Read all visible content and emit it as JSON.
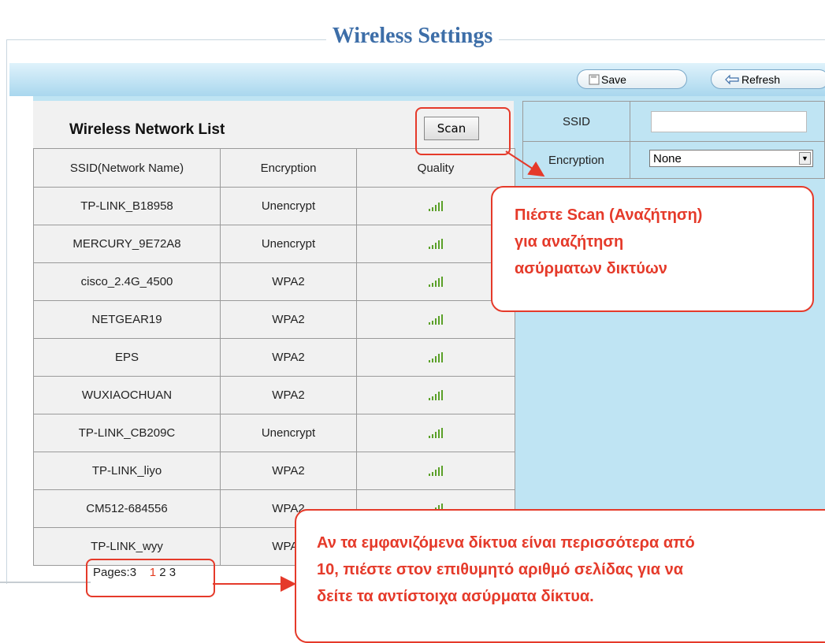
{
  "page": {
    "title": "Wireless Settings"
  },
  "toolbar": {
    "save_label": "Save",
    "refresh_label": "Refresh"
  },
  "network_list": {
    "title": "Wireless Network List",
    "scan_label": "Scan",
    "columns": [
      "SSID(Network Name)",
      "Encryption",
      "Quality"
    ],
    "rows": [
      {
        "ssid": "TP-LINK_B18958",
        "encryption": "Unencrypt"
      },
      {
        "ssid": "MERCURY_9E72A8",
        "encryption": "Unencrypt"
      },
      {
        "ssid": "cisco_2.4G_4500",
        "encryption": "WPA2"
      },
      {
        "ssid": "NETGEAR19",
        "encryption": "WPA2"
      },
      {
        "ssid": "EPS",
        "encryption": "WPA2"
      },
      {
        "ssid": "WUXIAOCHUAN",
        "encryption": "WPA2"
      },
      {
        "ssid": "TP-LINK_CB209C",
        "encryption": "Unencrypt"
      },
      {
        "ssid": "TP-LINK_liyo",
        "encryption": "WPA2"
      },
      {
        "ssid": "CM512-684556",
        "encryption": "WPA2"
      },
      {
        "ssid": "TP-LINK_wyy",
        "encryption": "WPA2"
      }
    ],
    "quality_icon": "signal-bars-icon",
    "pages_label": "Pages:3",
    "page_numbers": [
      "1",
      "2",
      "3"
    ]
  },
  "form": {
    "ssid_label": "SSID",
    "ssid_value": "",
    "encryption_label": "Encryption",
    "encryption_value": "None"
  },
  "callouts": {
    "scan_line1": "Πιέστε Scan (Αναζήτηση)",
    "scan_line2": "για αναζήτηση",
    "scan_line3": "ασύρματων δικτύων",
    "pages_line1": "Αν τα εμφανιζόμενα δίκτυα είναι περισσότερα από",
    "pages_line2": "10, πιέστε στον επιθυμητό αριθμό σελίδας για να",
    "pages_line3": "δείτε τα αντίστοιχα ασύρματα δίκτυα."
  },
  "colors": {
    "accent": "#3d6ea8",
    "callout": "#e53a2a",
    "signal": "#5aa028"
  }
}
